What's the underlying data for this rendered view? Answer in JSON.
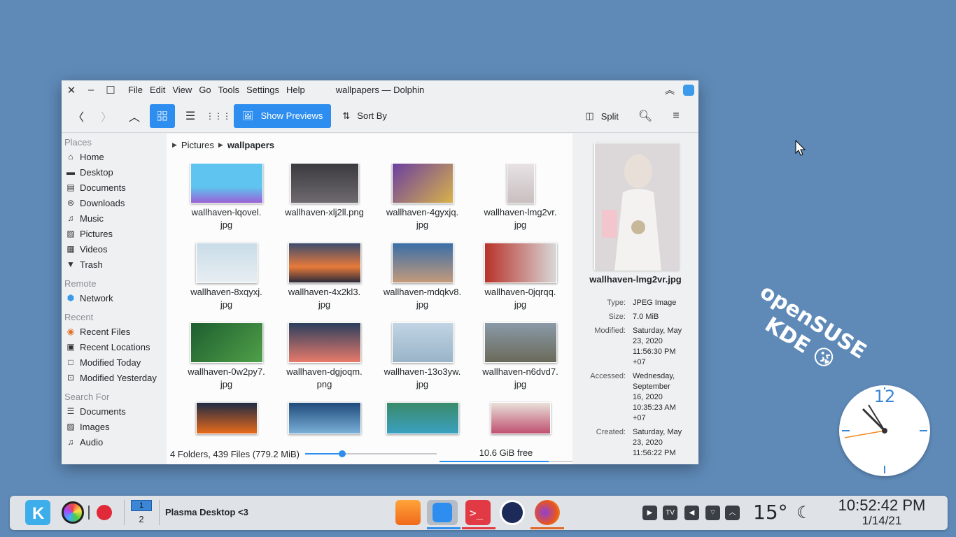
{
  "window": {
    "title": "wallpapers — Dolphin",
    "menu": [
      "File",
      "Edit",
      "View",
      "Go",
      "Tools",
      "Settings",
      "Help"
    ]
  },
  "toolbar": {
    "show_previews": "Show Previews",
    "sort_by": "Sort By",
    "split": "Split"
  },
  "sidebar": {
    "places_header": "Places",
    "places": [
      "Home",
      "Desktop",
      "Documents",
      "Downloads",
      "Music",
      "Pictures",
      "Videos",
      "Trash"
    ],
    "remote_header": "Remote",
    "remote": [
      "Network"
    ],
    "recent_header": "Recent",
    "recent": [
      "Recent Files",
      "Recent Locations",
      "Modified Today",
      "Modified Yesterday"
    ],
    "search_header": "Search For",
    "search": [
      "Documents",
      "Images",
      "Audio"
    ]
  },
  "breadcrumb": [
    "Pictures",
    "wallpapers"
  ],
  "files": [
    {
      "l1": "wallhaven-lqovel.",
      "l2": "jpg"
    },
    {
      "l1": "wallhaven-xlj2ll.png",
      "l2": ""
    },
    {
      "l1": "wallhaven-4gyxjq.",
      "l2": "jpg"
    },
    {
      "l1": "wallhaven-lmg2vr.",
      "l2": "jpg"
    },
    {
      "l1": "wallhaven-8xqyxj.",
      "l2": "jpg"
    },
    {
      "l1": "wallhaven-4x2kl3.",
      "l2": "jpg"
    },
    {
      "l1": "wallhaven-mdqkv8.",
      "l2": "jpg"
    },
    {
      "l1": "wallhaven-0jqrqq.",
      "l2": "jpg"
    },
    {
      "l1": "wallhaven-0w2py7.",
      "l2": "jpg"
    },
    {
      "l1": "wallhaven-dgjoqm.",
      "l2": "png"
    },
    {
      "l1": "wallhaven-13o3yw.",
      "l2": "jpg"
    },
    {
      "l1": "wallhaven-n6dvd7.",
      "l2": "jpg"
    },
    {
      "l1": "",
      "l2": ""
    },
    {
      "l1": "",
      "l2": ""
    },
    {
      "l1": "",
      "l2": ""
    },
    {
      "l1": "",
      "l2": ""
    }
  ],
  "status": {
    "summary": "4 Folders, 439 Files (779.2 MiB)",
    "free": "10.6 GiB free",
    "zoom_fraction": 0.28,
    "disk_used_fraction": 0.82
  },
  "info": {
    "filename": "wallhaven-lmg2vr.jpg",
    "type_k": "Type:",
    "type_v": "JPEG Image",
    "size_k": "Size:",
    "size_v": "7.0 MiB",
    "modified_k": "Modified:",
    "modified_v": [
      "Saturday, May",
      "23, 2020",
      "11:56:30 PM",
      "+07"
    ],
    "accessed_k": "Accessed:",
    "accessed_v": [
      "Wednesday,",
      "September",
      "16, 2020",
      "10:35:23 AM",
      "+07"
    ],
    "created_k": "Created:",
    "created_v": [
      "Saturday, May",
      "23, 2020",
      "11:56:22 PM"
    ]
  },
  "desktop": {
    "text_line1": "openSUSE",
    "text_line2": "KDE 😘",
    "clock_label": "12"
  },
  "panel": {
    "pager_1": "1",
    "pager_2": "2",
    "active_window": "Plasma Desktop <3",
    "tray_tv": "TV",
    "temperature": "15°",
    "time": "10:52:42 PM",
    "date": "1/14/21"
  }
}
